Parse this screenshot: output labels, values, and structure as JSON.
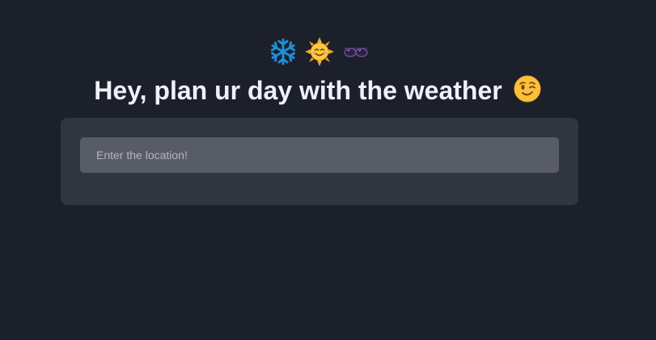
{
  "header": {
    "icons": [
      "snowflake-icon",
      "smiling-sun-icon",
      "sunglasses-icon"
    ],
    "title": "Hey, plan ur day with the weather",
    "title_icon": "winking-face-icon"
  },
  "search": {
    "placeholder": "Enter the location!",
    "value": ""
  },
  "colors": {
    "background": "#1c202b",
    "card": "#313540",
    "input": "#585c66",
    "title_text": "#eef1f7",
    "snowflake": "#1e90d6",
    "sun": "#f7b731"
  }
}
